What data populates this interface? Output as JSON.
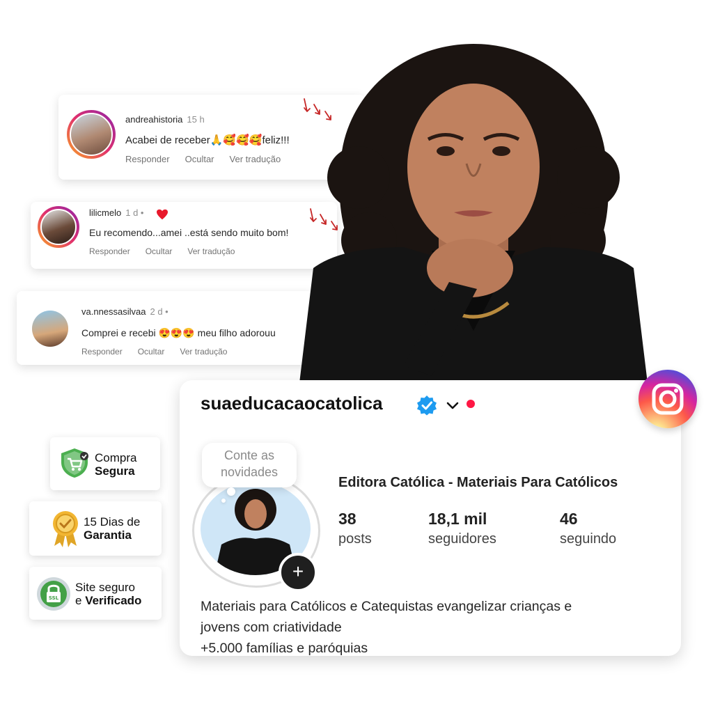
{
  "comments": [
    {
      "user": "andreahistoria",
      "time": "15 h",
      "text": "Acabei de receber🙏🥰🥰🥰feliz!!!",
      "actions": [
        "Responder",
        "Ocultar",
        "Ver tradução"
      ]
    },
    {
      "user": "lilicmelo",
      "time": "1 d •",
      "text": "Eu recomendo...amei ..está sendo muito bom!",
      "actions": [
        "Responder",
        "Ocultar",
        "Ver tradução"
      ]
    },
    {
      "user": "va.nnessasilvaa",
      "time": "2 d •",
      "text": "Comprei e recebi 😍😍😍 meu filho adorouu",
      "actions": [
        "Responder",
        "Ocultar",
        "Ver tradução"
      ]
    }
  ],
  "profile": {
    "username": "suaeducacaocatolica",
    "bubble": "Conte as novidades",
    "name": "Editora Católica - Materiais Para Católicos",
    "stats": [
      {
        "value": "38",
        "label": "posts"
      },
      {
        "value": "18,1 mil",
        "label": "seguidores"
      },
      {
        "value": "46",
        "label": "seguindo"
      }
    ],
    "bio": [
      "Materiais para Católicos e Catequistas evangelizar crianças e",
      "jovens com criatividade",
      "+5.000 famílias e paróquias"
    ]
  },
  "badges": [
    {
      "line1": "Compra",
      "line2": "Segura",
      "icon": "shield-cart-icon"
    },
    {
      "line1": "15 Dias de",
      "line2": "Garantia",
      "icon": "gold-medal-icon"
    },
    {
      "line1": "Site seguro",
      "line2_prefix": "e ",
      "line2": "Verificado",
      "icon": "ssl-lock-icon"
    }
  ],
  "colors": {
    "verified": "#1d9bf0",
    "accent_red": "#ff1744",
    "badge_green": "#4caf50"
  }
}
